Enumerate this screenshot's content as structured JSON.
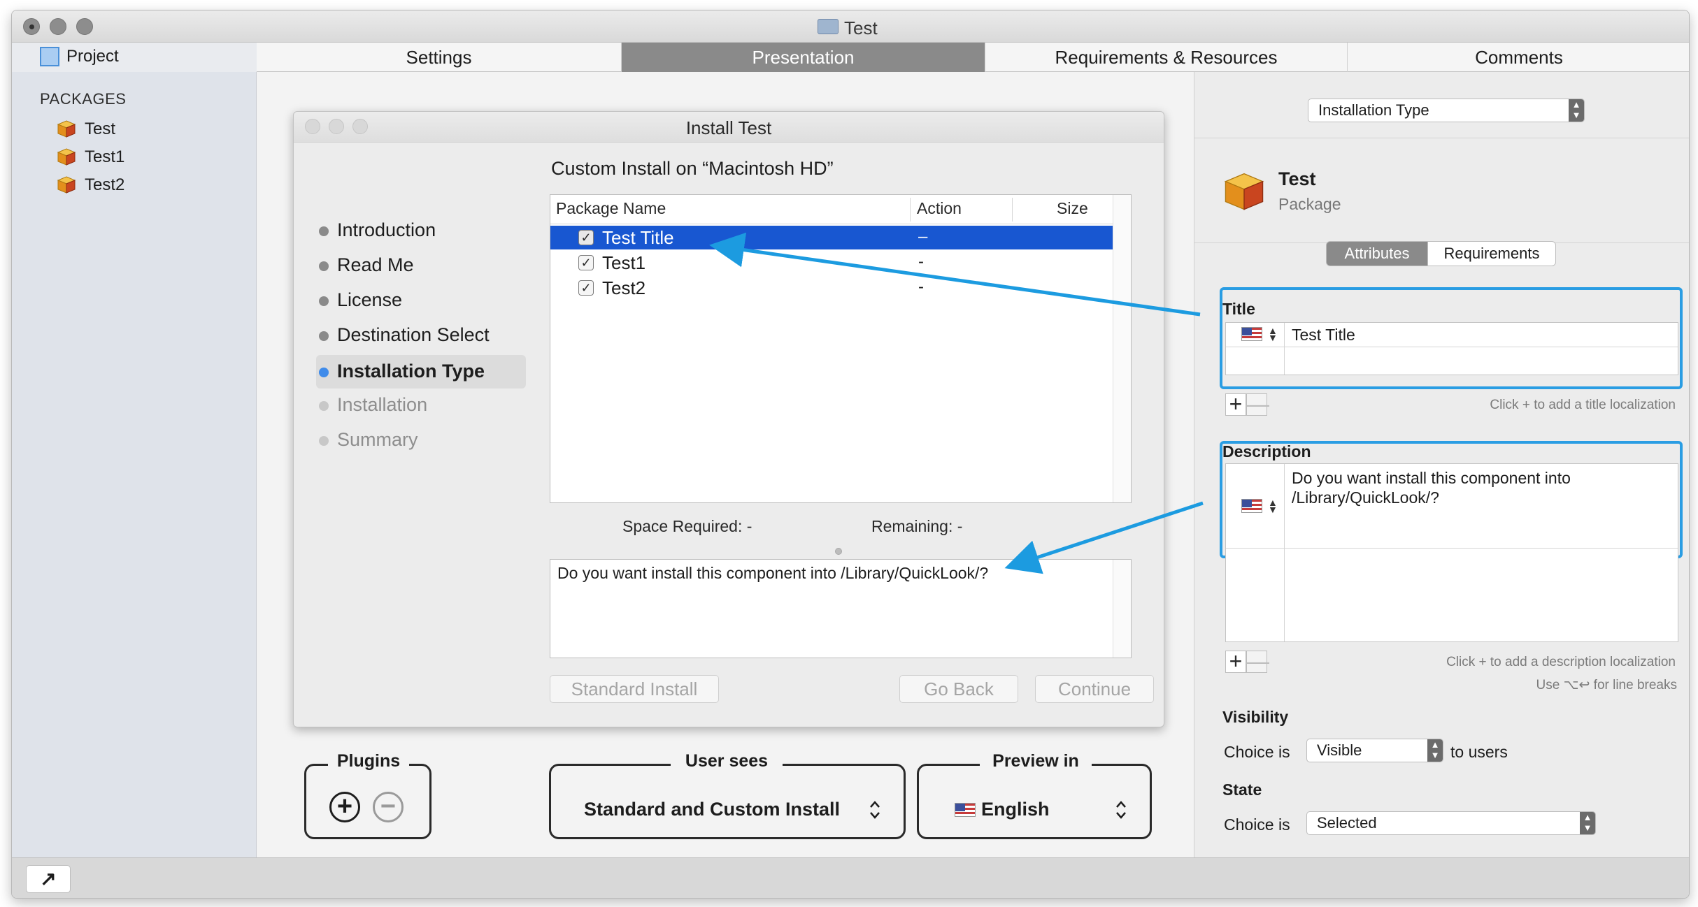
{
  "window": {
    "title": "Test"
  },
  "sidebar": {
    "project_label": "Project",
    "packages_heading": "PACKAGES",
    "packages": [
      "Test",
      "Test1",
      "Test2"
    ]
  },
  "tabs": [
    {
      "label": "Settings",
      "active": false
    },
    {
      "label": "Presentation",
      "active": true
    },
    {
      "label": "Requirements & Resources",
      "active": false
    },
    {
      "label": "Comments",
      "active": false
    }
  ],
  "dialog": {
    "title": "Install Test",
    "steps": [
      {
        "label": "Introduction",
        "state": "normal"
      },
      {
        "label": "Read Me",
        "state": "normal"
      },
      {
        "label": "License",
        "state": "normal"
      },
      {
        "label": "Destination Select",
        "state": "normal"
      },
      {
        "label": "Installation Type",
        "state": "current"
      },
      {
        "label": "Installation",
        "state": "dim"
      },
      {
        "label": "Summary",
        "state": "dim"
      }
    ],
    "custom_heading": "Custom Install on “Macintosh HD”",
    "columns": {
      "name": "Package Name",
      "action": "Action",
      "size": "Size"
    },
    "packages": [
      {
        "name": "Test Title",
        "action": "–",
        "checked": true,
        "selected": true
      },
      {
        "name": "Test1",
        "action": "-",
        "checked": true,
        "selected": false
      },
      {
        "name": "Test2",
        "action": "-",
        "checked": true,
        "selected": false
      }
    ],
    "checkmark": "✓",
    "space_required": "Space Required:  -",
    "remaining": "Remaining:  -",
    "description": "Do you want install this component into /Library/QuickLook/?",
    "buttons": {
      "standard": "Standard Install",
      "back": "Go Back",
      "continue": "Continue"
    }
  },
  "bottom_controls": {
    "plugins": {
      "title": "Plugins",
      "add": "+",
      "remove": "−"
    },
    "user_sees": {
      "title": "User sees",
      "value": "Standard and Custom Install"
    },
    "preview_in": {
      "title": "Preview in",
      "value": "English"
    },
    "updown": "⌃\n⌄"
  },
  "inspector": {
    "choice_popup": "Installation Type",
    "package_name": "Test",
    "package_type": "Package",
    "segments": {
      "attributes": "Attributes",
      "requirements": "Requirements"
    },
    "title_section": {
      "label": "Title",
      "value": "Test Title",
      "hint": "Click + to add a title localization"
    },
    "description_section": {
      "label": "Description",
      "value": "Do you want install this component into /Library/QuickLook/?",
      "hint": "Click + to add a description localization",
      "hint2": "Use ⌥↩ for line breaks"
    },
    "visibility": {
      "label": "Visibility",
      "prefix": "Choice is",
      "value": "Visible",
      "suffix": "to users"
    },
    "state": {
      "label": "State",
      "prefix": "Choice is",
      "value": "Selected"
    },
    "plus": "+",
    "minus": "—"
  },
  "bottom_button": {
    "glyph": "↗"
  },
  "colors": {
    "selection": "#1857d1",
    "highlight": "#2a9de3",
    "active_tab": "#8a8a8a"
  }
}
